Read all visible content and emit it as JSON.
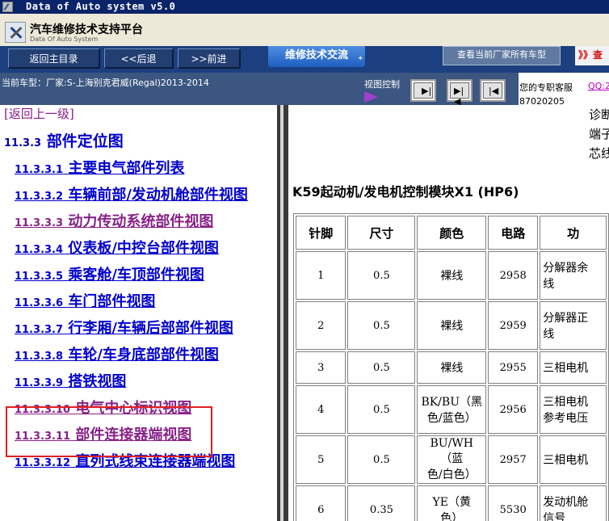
{
  "window": {
    "title": "Data of Auto system v5.0"
  },
  "header": {
    "brand_cn": "汽车维修技术支持平台",
    "brand_en": "Data Of Auto System"
  },
  "toolbar": {
    "home_label": "返回主目录",
    "back_label": "<<后退",
    "forward_label": ">>前进",
    "tab_label": "维修技术交流",
    "cars_label": "查看当前厂家所有车型",
    "red_label": "》》查"
  },
  "infobar": {
    "current_car": "当前车型：厂家:S-上海别克君威(Regal)2013-2014",
    "view_control": "视图控制",
    "support_label": "您的专职客服",
    "support_qq": "QQ:2",
    "support_num": "87020205"
  },
  "nav": {
    "back_link": "[返回上一级]",
    "section": {
      "num": "11.3.3",
      "title": "部件定位图"
    },
    "items": [
      {
        "num": "11.3.3.1",
        "title": "主要电气部件列表"
      },
      {
        "num": "11.3.3.2",
        "title": "车辆前部/发动机舱部件视图"
      },
      {
        "num": "11.3.3.3",
        "title": "动力传动系统部件视图"
      },
      {
        "num": "11.3.3.4",
        "title": "仪表板/中控台部件视图"
      },
      {
        "num": "11.3.3.5",
        "title": "乘客舱/车顶部件视图"
      },
      {
        "num": "11.3.3.6",
        "title": "车门部件视图"
      },
      {
        "num": "11.3.3.7",
        "title": "行李厢/车辆后部部件视图"
      },
      {
        "num": "11.3.3.8",
        "title": "车轮/车身底部部件视图"
      },
      {
        "num": "11.3.3.9",
        "title": "搭铁视图"
      },
      {
        "num": "11.3.3.10",
        "title": "电气中心标识视图"
      },
      {
        "num": "11.3.3.11",
        "title": "部件连接器端视图"
      },
      {
        "num": "11.3.3.12",
        "title": "直列式线束连接器端视图"
      }
    ]
  },
  "content": {
    "top_note": [
      "诊断",
      "端子",
      "芯线"
    ],
    "table_title": "K59起动机/发电机控制模块X1 (HP6)",
    "headers": [
      "针脚",
      "尺寸",
      "颜色",
      "电路",
      "功"
    ],
    "rows": [
      {
        "pin": "1",
        "size": "0.5",
        "color": "裸线",
        "circuit": "2958",
        "desc": "分解器余\n线"
      },
      {
        "pin": "2",
        "size": "0.5",
        "color": "裸线",
        "circuit": "2959",
        "desc": "分解器正\n线"
      },
      {
        "pin": "3",
        "size": "0.5",
        "color": "裸线",
        "circuit": "2955",
        "desc": "三相电机"
      },
      {
        "pin": "4",
        "size": "0.5",
        "color": "BK/BU（黑\n色/蓝色）",
        "circuit": "2956",
        "desc": "三相电机\n参考电压"
      },
      {
        "pin": "5",
        "size": "0.5",
        "color": "BU/WH（蓝\n色/白色）",
        "circuit": "2957",
        "desc": "三相电机"
      },
      {
        "pin": "6",
        "size": "0.35",
        "color": "YE（黄\n色）",
        "circuit": "5530",
        "desc": "发动机舱\n信号"
      }
    ]
  },
  "colors": {
    "link": "#0000cc",
    "visited": "#882288",
    "highlight": "#e02020",
    "toolbar": "#1c3f7f"
  }
}
